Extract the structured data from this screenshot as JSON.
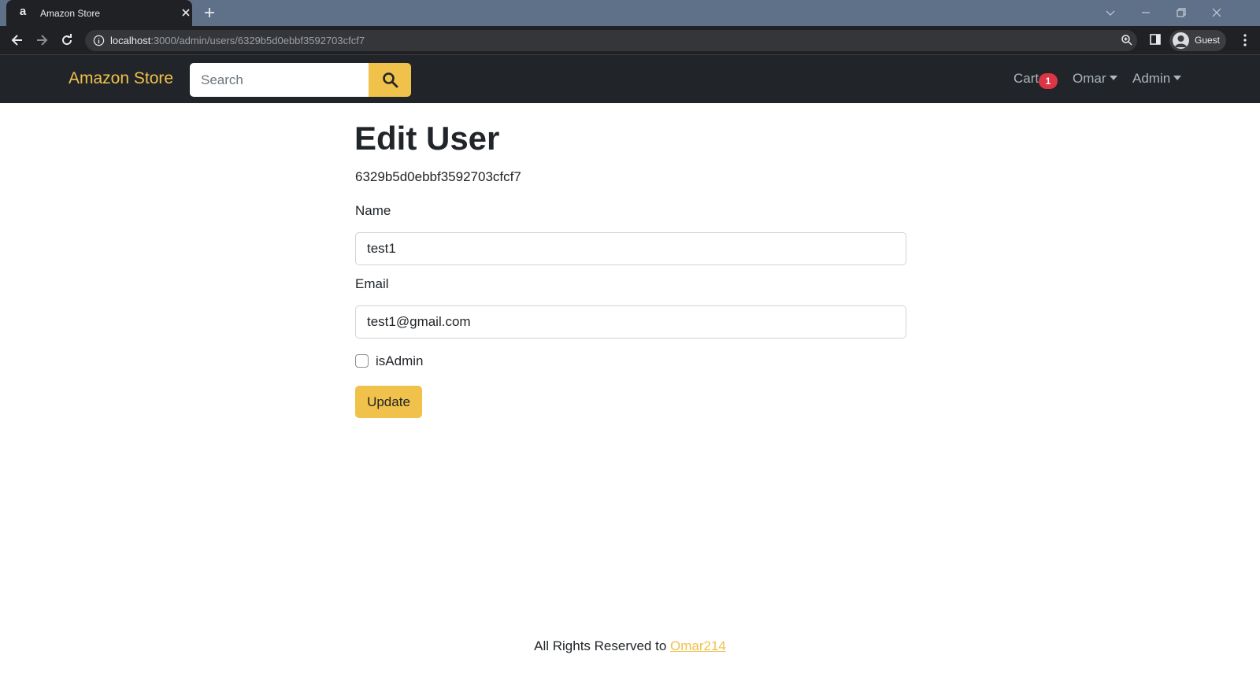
{
  "browser": {
    "tab_title": "Amazon Store",
    "tab_favicon": "a",
    "url_host": "localhost",
    "url_path": ":3000/admin/users/6329b5d0ebbf3592703cfcf7",
    "profile_label": "Guest"
  },
  "navbar": {
    "brand": "Amazon Store",
    "search_placeholder": "Search",
    "cart_label": "Cart",
    "cart_count": "1",
    "user_menu_label": "Omar",
    "admin_menu_label": "Admin"
  },
  "main": {
    "title": "Edit User",
    "user_id": "6329b5d0ebbf3592703cfcf7",
    "name_label": "Name",
    "name_value": "test1",
    "email_label": "Email",
    "email_value": "test1@gmail.com",
    "is_admin_label": "isAdmin",
    "is_admin_checked": false,
    "update_label": "Update"
  },
  "footer": {
    "text": "All Rights Reserved to ",
    "link_text": "Omar214"
  },
  "colors": {
    "accent": "#f0c14b",
    "navbar_bg": "#212529",
    "badge": "#dc3545"
  }
}
